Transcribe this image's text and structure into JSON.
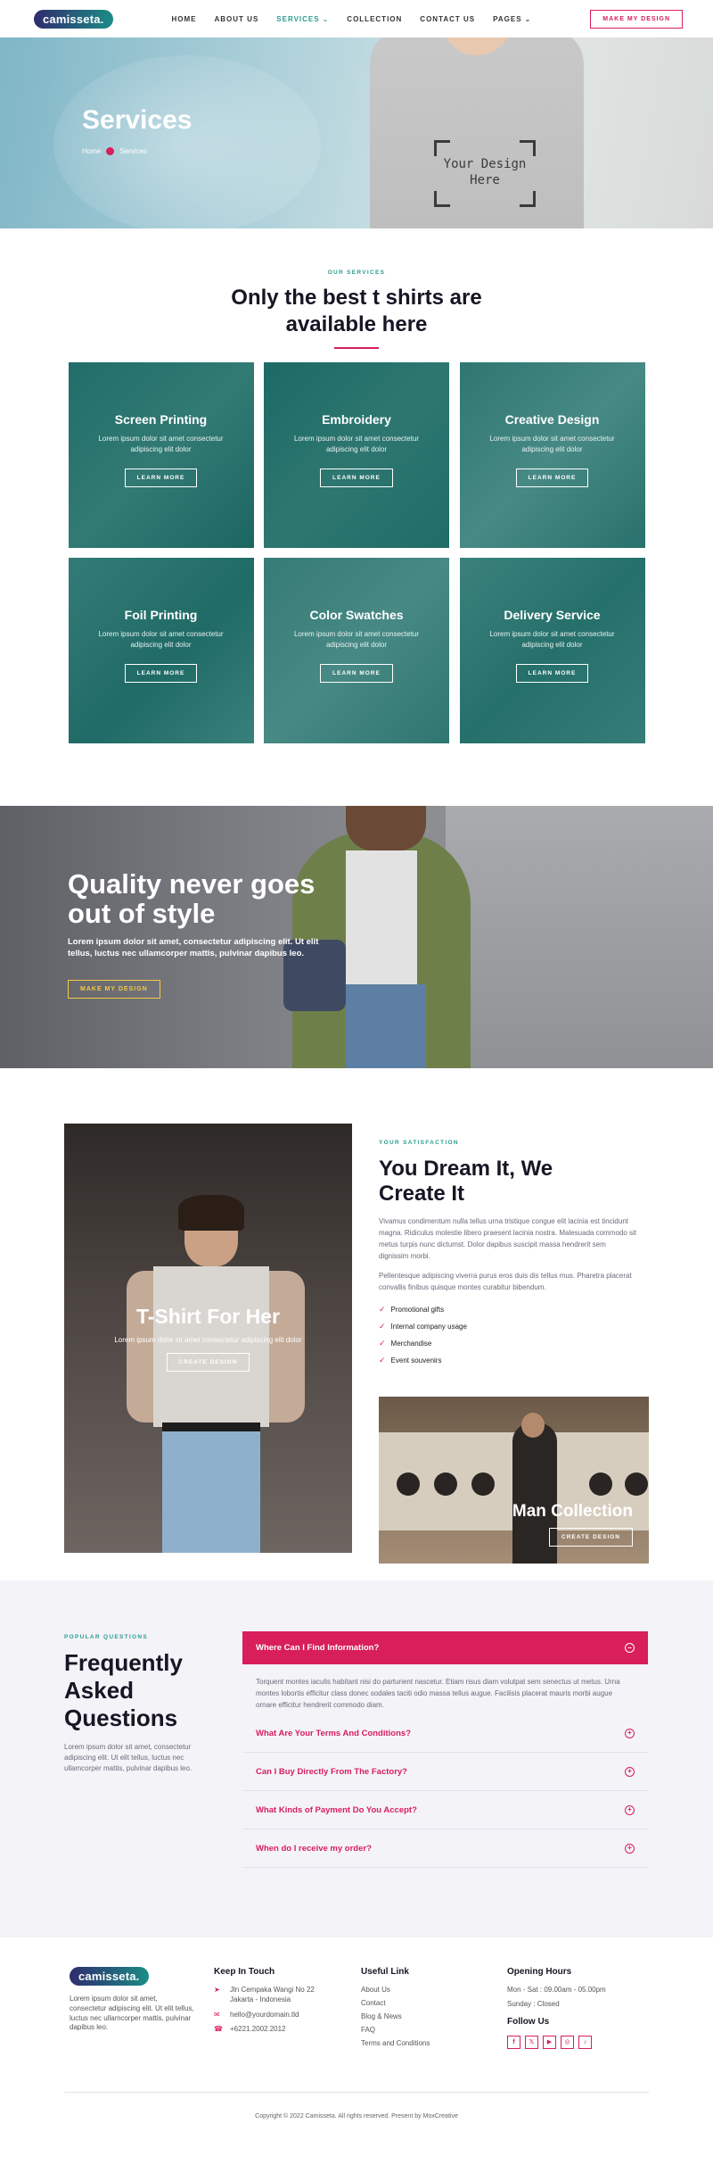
{
  "header": {
    "logo": "camisseta.",
    "nav": [
      {
        "label": "HOME",
        "active": false,
        "dropdown": false
      },
      {
        "label": "ABOUT US",
        "active": false,
        "dropdown": false
      },
      {
        "label": "SERVICES",
        "active": true,
        "dropdown": true
      },
      {
        "label": "COLLECTION",
        "active": false,
        "dropdown": false
      },
      {
        "label": "CONTACT US",
        "active": false,
        "dropdown": false
      },
      {
        "label": "PAGES",
        "active": false,
        "dropdown": true
      }
    ],
    "cta": "MAKE MY DESIGN"
  },
  "hero": {
    "title": "Services",
    "breadcrumb": [
      "Home",
      "Services"
    ],
    "shirt_text_line1": "Your Design",
    "shirt_text_line2": "Here"
  },
  "services": {
    "eyebrow": "OUR SERVICES",
    "title": "Only the best t shirts are available here",
    "cards": [
      {
        "title": "Screen Printing",
        "text": "Lorem ipsum dolor sit amet consectetur adipiscing elit dolor",
        "button": "LEARN MORE"
      },
      {
        "title": "Embroidery",
        "text": "Lorem ipsum dolor sit amet consectetur adipiscing elit dolor",
        "button": "LEARN MORE"
      },
      {
        "title": "Creative Design",
        "text": "Lorem ipsum dolor sit amet consectetur adipiscing elit dolor",
        "button": "LEARN MORE"
      },
      {
        "title": "Foil Printing",
        "text": "Lorem ipsum dolor sit amet consectetur adipiscing elit dolor",
        "button": "LEARN MORE"
      },
      {
        "title": "Color Swatches",
        "text": "Lorem ipsum dolor sit amet consectetur adipiscing elit dolor",
        "button": "LEARN MORE"
      },
      {
        "title": "Delivery Service",
        "text": "Lorem ipsum dolor sit amet consectetur adipiscing elit dolor",
        "button": "LEARN MORE"
      }
    ]
  },
  "quality": {
    "title": "Quality never goes out of style",
    "text": "Lorem ipsum dolor sit amet, consectetur adipiscing elit. Ut elit tellus, luctus nec ullamcorper mattis, pulvinar dapibus leo.",
    "button": "MAKE MY DESIGN"
  },
  "dream": {
    "her_title": "T-Shirt For Her",
    "her_text": "Lorem ipsum dolor sit amet consectetur adipiscing elit dolor",
    "her_button": "CREATE DESIGN",
    "eyebrow": "YOUR SATISFACTION",
    "title": "You Dream It, We Create It",
    "para1": "Vivamus condimentum nulla tellus urna tristique congue elit lacinia est tincidunt magna. Ridiculus molestie libero praesent lacinia nostra. Malesuada commodo sit metus turpis nunc dictumst. Dolor dapibus suscipit massa hendrerit sem dignissim morbi.",
    "para2": "Pellentesque adipiscing viverra purus eros duis dis tellus mus. Pharetra placerat convallis finibus quisque montes curabitur bibendum.",
    "checks": [
      "Promotional gifts",
      "Internal company usage",
      "Merchandise",
      "Event souvenirs"
    ],
    "man_title": "Man Collection",
    "man_button": "CREATE DESIGN"
  },
  "faq": {
    "eyebrow": "POPULAR QUESTIONS",
    "title": "Frequently Asked Questions",
    "text": "Lorem ipsum dolor sit amet, consectetur adipiscing elit. Ut elit tellus, luctus nec ullamcorper mattis, pulvinar dapibus leo.",
    "open_question": "Where Can I Find Information?",
    "open_answer": "Torquent montes iaculis habitant nisi do parturient nascetur. Etiam risus diam volutpat sem senectus ut metus. Urna montes lobortis efficitur class donec sodales taciti odio massa tellus augue. Facilisis placerat mauris morbi augue ornare efficitur hendrerit commodo diam.",
    "questions": [
      "What Are Your Terms And Conditions?",
      "Can I Buy Directly From The Factory?",
      "What Kinds of Payment Do You Accept?",
      "When do I receive my order?"
    ]
  },
  "footer": {
    "logo": "camisseta.",
    "about": "Lorem ipsum dolor sit amet, consectetur adipiscing elit. Ut elit tellus, luctus nec ullamcorper mattis, pulvinar dapibus leo.",
    "touch_title": "Keep In Touch",
    "address_line1": "Jln Cempaka Wangi No 22",
    "address_line2": "Jakarta - Indonesia",
    "email": "hello@yourdomain.tld",
    "phone": "+6221.2002.2012",
    "links_title": "Useful Link",
    "links": [
      "About Us",
      "Contact",
      "Blog & News",
      "FAQ",
      "Terms and Conditions"
    ],
    "hours_title": "Opening Hours",
    "hours1": "Mon - Sat : 09.00am - 05.00pm",
    "hours2": "Sunday : Closed",
    "follow_title": "Follow Us",
    "copyright": "Copyright © 2022 Camisseta. All rights reserved. Present by MoxCreative"
  },
  "colors": {
    "accent": "#d81e5b",
    "teal": "#2a9d8f",
    "yellow": "#f5c842"
  }
}
